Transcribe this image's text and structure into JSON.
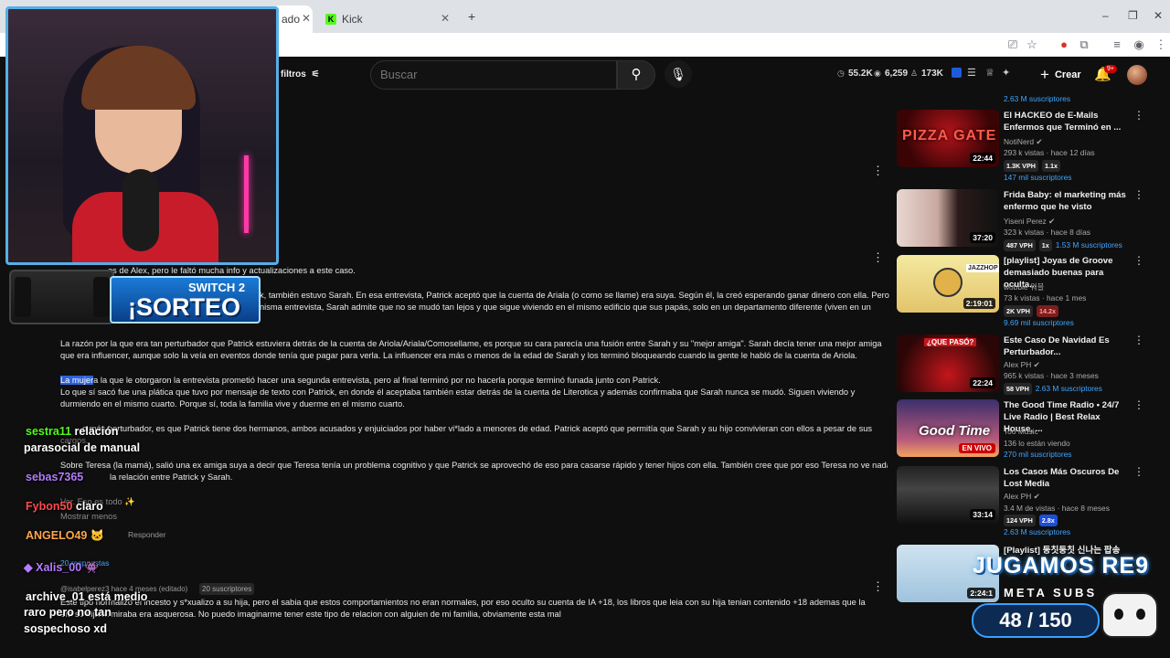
{
  "browser": {
    "tabs": [
      {
        "label": "ado",
        "active": true
      },
      {
        "label": "Kick",
        "active": false
      }
    ],
    "new_tab": "+",
    "window_controls": [
      "–",
      "❐",
      "✕"
    ]
  },
  "youtube": {
    "filters_label": "filtros",
    "search_placeholder": "Buscar",
    "stats": {
      "a": "55.2K",
      "b": "6,259",
      "c": "173K"
    },
    "create_label": "Crear",
    "notif_badge": "9+"
  },
  "comments": [
    {
      "text": "os de Alex, pero le faltó mucha info y actualizaciones a este caso."
    },
    {
      "text": "k, también estuvo Sarah. En esa entrevista, Patrick aceptó que la cuenta de Ariala (o como se llame) era suya. Según él, la creó esperando ganar dinero con ella. Pero"
    },
    {
      "text": "nisma entrevista, Sarah admite que no se mudó tan lejos y que sigue viviendo en el mismo edificio que sus papás, solo en un departamento diferente (viven en un"
    },
    {
      "text": "La razón por la que era tan perturbador que Patrick estuviera detrás de la cuenta de Ariola/Ariala/Comosellame, es porque su cara parecía una fusión entre Sarah y su \"mejor amiga\". Sarah decía tener una mejor amiga"
    },
    {
      "text": "que era influencer, aunque solo la veía en eventos donde tenía que pagar para verla. La influencer era más o menos de la edad de Sarah y los terminó bloqueando cuando la gente le habló de la cuenta de Ariola."
    },
    {
      "highlight": "La mujer",
      "text": "a la que le otorgaron la entrevista prometió hacer una segunda entrevista, pero al final terminó por no hacerla porque terminó funada junto con Patrick."
    },
    {
      "text": "Lo que sí sacó fue una plática que tuvo por mensaje de texto con Patrick, en donde él aceptaba también estar detrás de la cuenta de Literotica y además confirmaba que Sarah nunca se mudó. Siguen viviendo y"
    },
    {
      "text": "durmiendo en el mismo cuarto. Porque sí, toda la familia vive y duerme en el mismo cuarto."
    },
    {
      "text": "o más perturbador, es que Patrick tiene dos hermanos, ambos acusados y enjuiciados por haber vi*lado a menores de edad. Patrick aceptó que permitía que Sarah y su hijo convivieran con ellos a pesar de sus"
    },
    {
      "text": "cargos."
    },
    {
      "text": "Sobre Teresa (la mamá), salió una ex amiga suya a decir que Teresa tenía un problema cognitivo y que Patrick se aprovechó de eso para casarse rápido y tener hijos con ella. También cree que por eso Teresa no ve nada"
    },
    {
      "text": "la relación entre Patrick y Sarah."
    },
    {
      "text": "Ver. Eso es todo ✨"
    },
    {
      "text": "Mostrar menos"
    },
    {
      "text": "Responder"
    },
    {
      "text": "20 respuestas"
    },
    {
      "text": "@isabelperez3  hace 4 meses (editado)"
    },
    {
      "text": "20 suscriptores"
    },
    {
      "text": "Este tipo normalizo el incesto y s*xualizo a su hija, pero el sabia que estos comportamientos no eran normales, por eso oculto su cuenta de IA +18, los libros que leia con su hija tenian contenido +18 ademas que la"
    },
    {
      "text": "era su hija la miraba era asquerosa. No puedo imaginarme tener este tipo de relacion con alguien de mi familia, obviamente esta mal"
    }
  ],
  "recommendations": [
    {
      "title": "",
      "meta1": "",
      "meta2": "",
      "subs": "2.63 M suscriptores",
      "duration": ""
    },
    {
      "title": "El HACKEO de E-Mails Enfermos que Terminó en ...",
      "channel": "NotiNerd",
      "views": "293 k vistas · hace 12 días",
      "vph": "1.3K VPH",
      "mult": "1.1x",
      "subs": "147 mil suscriptores",
      "duration": "22:44",
      "thumb_text": "PIZZA GATE"
    },
    {
      "title": "Frida Baby: el marketing más enfermo que he visto",
      "channel": "Yiseni Perez",
      "views": "323 k vistas · hace 8 días",
      "vph": "487 VPH",
      "mult": "1x",
      "subs": "1.53 M suscriptores",
      "duration": "37:20"
    },
    {
      "title": "[playlist] Joyas de Groove demasiado buenas para oculta...",
      "channel": "wobble 워블",
      "views": "73 k vistas · hace 1 mes",
      "vph": "2K VPH",
      "mult": "14.2x",
      "subs": "9.69 mil suscriptores",
      "duration": "2:19:01",
      "thumb_text": "JAZZHOP"
    },
    {
      "title": "Este Caso De Navidad Es Perturbador...",
      "channel": "Alex PH",
      "views": "965 k vistas · hace 3 meses",
      "vph": "58 VPH",
      "mult": "2.63 M suscriptores",
      "subs": "",
      "duration": "22:24",
      "thumb_text": "¿QUE PASÓ?"
    },
    {
      "title": "The Good Time Radio • 24/7 Live Radio | Best Relax House, ...",
      "channel": "Too Music",
      "views": "136 lo están viendo",
      "vph": "",
      "mult": "",
      "subs": "270 mil suscriptores",
      "duration": "EN VIVO",
      "thumb_text": "Good Time"
    },
    {
      "title": "Los Casos Más Oscuros De Lost Media",
      "channel": "Alex PH",
      "views": "3.4 M de vistas · hace 8 meses",
      "vph": "124 VPH",
      "mult": "2.8x",
      "subs": "2.63 M suscriptores",
      "duration": "33:14"
    },
    {
      "title": "[Playlist] 둥칫둥칫 신나는 팝송",
      "channel": "",
      "views": "",
      "vph": "",
      "mult": "",
      "subs": "",
      "duration": "2:24:1"
    }
  ],
  "overlay": {
    "sorteo_top": "SWITCH 2",
    "sorteo_main": "¡SORTEO",
    "jugamos": "JUGAMOS RE9",
    "metasubs": "META SUBS",
    "counter": "48 / 150",
    "chat": [
      {
        "user": "sestra11",
        "msg": "relación"
      },
      {
        "user": "",
        "msg": "parasocial de manual"
      },
      {
        "user": "sebas7365",
        "msg": ""
      },
      {
        "user": "Fybon50",
        "msg": "claro"
      },
      {
        "user": "ANGELO49",
        "msg": ""
      },
      {
        "user": "Xalis_00",
        "msg": ""
      },
      {
        "user": "archive_01",
        "msg": "está medio"
      },
      {
        "user": "",
        "msg": "raro pero no tan"
      },
      {
        "user": "",
        "msg": "sospechoso xd"
      }
    ]
  },
  "colors": {
    "accent_blue": "#3ea6ff",
    "kick_green": "#53fc18",
    "youtube_red": "#cc0000"
  }
}
